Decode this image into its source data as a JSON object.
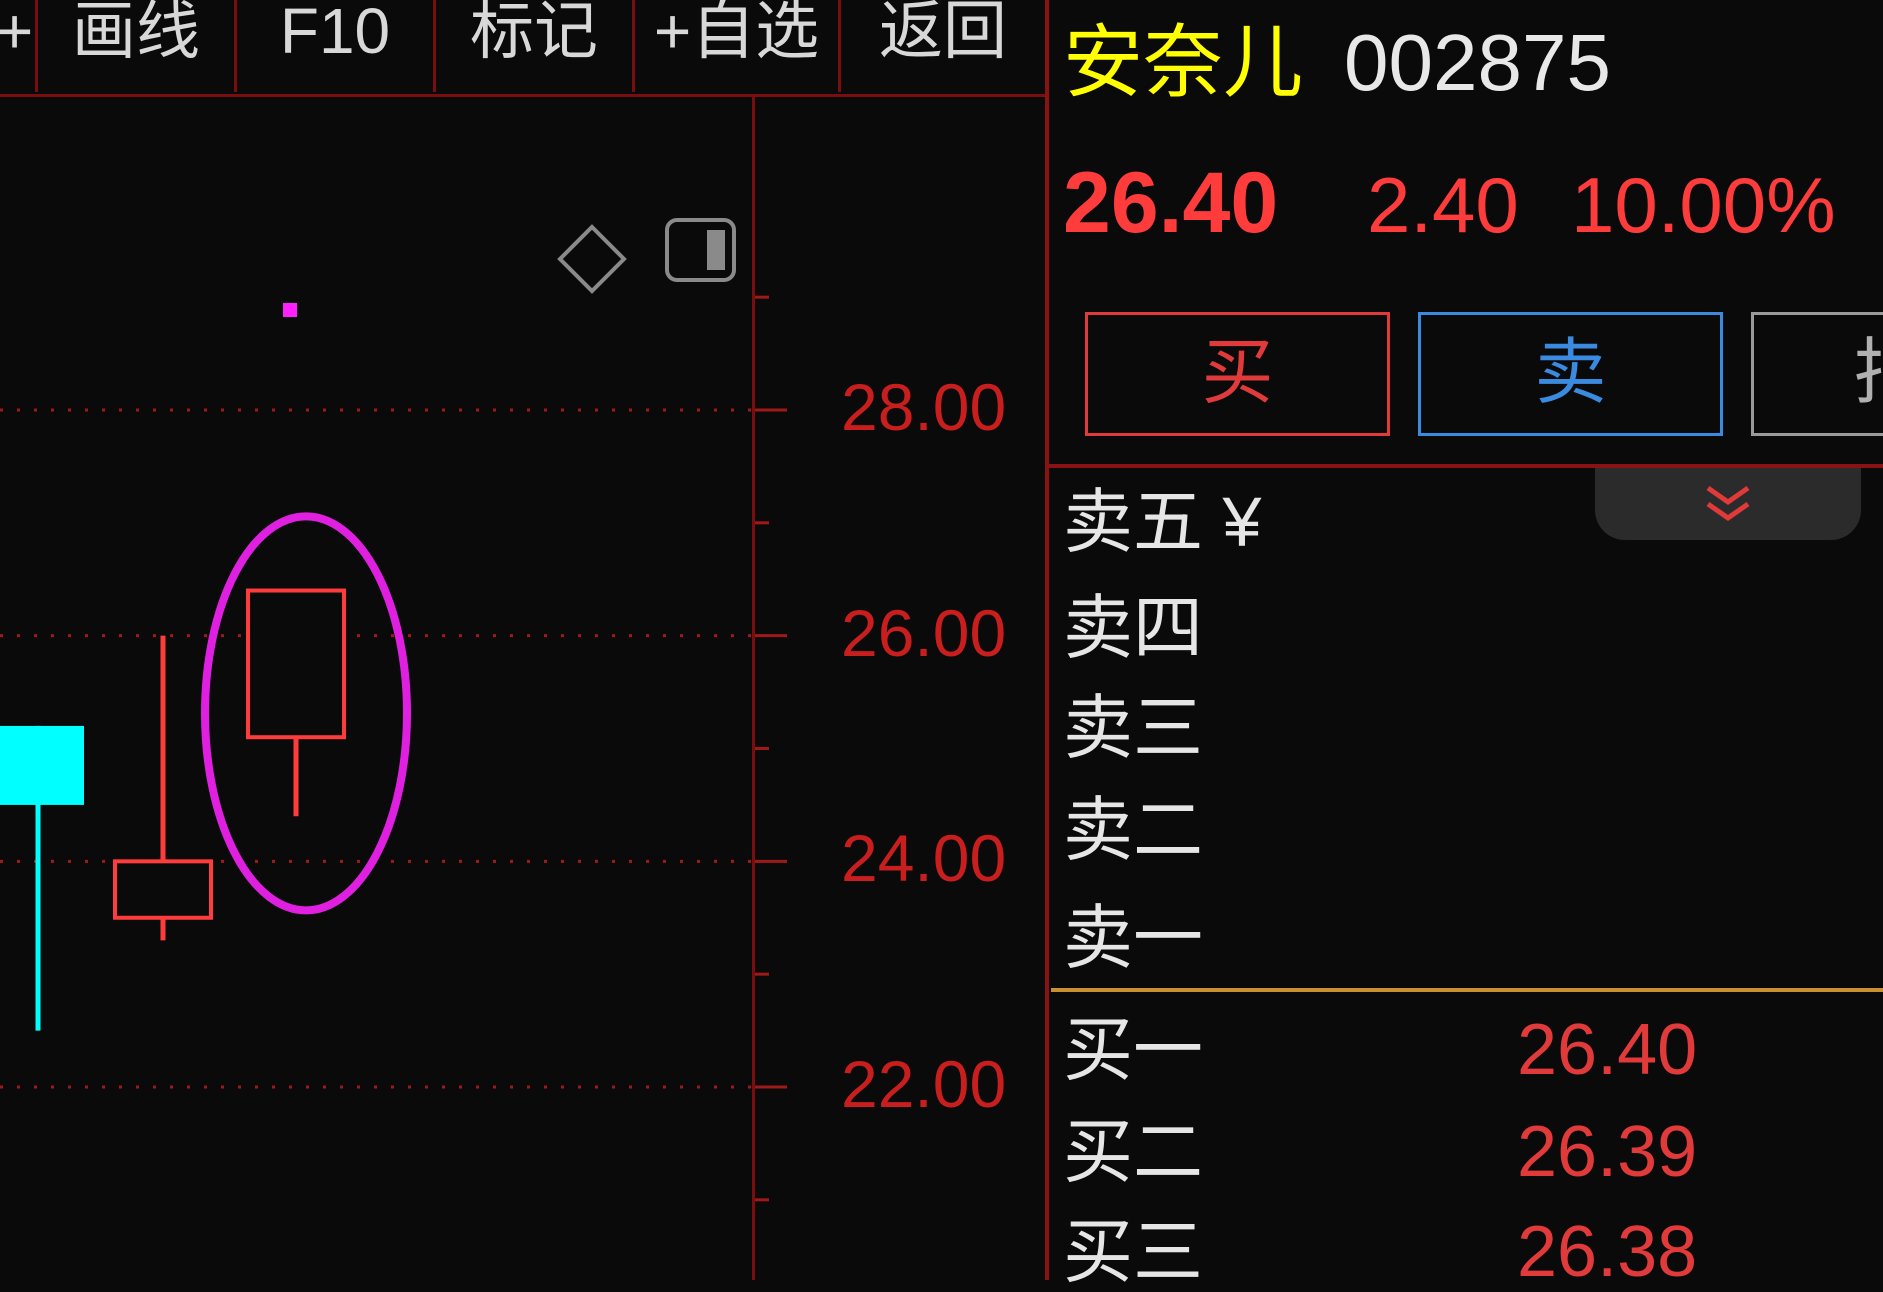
{
  "toolbar": {
    "items": [
      {
        "label": "+"
      },
      {
        "label": "画线"
      },
      {
        "label": "F10"
      },
      {
        "label": "标记"
      },
      {
        "label": "+自选"
      },
      {
        "label": "返回"
      }
    ]
  },
  "stock": {
    "name": "安奈儿",
    "code": "002875",
    "price": "26.40",
    "change": "2.40",
    "change_pct": "10.00%"
  },
  "trade": {
    "buy_label": "买",
    "sell_label": "卖",
    "third_label": "拍"
  },
  "order_book": {
    "asks": [
      {
        "label": "卖五 ¥"
      },
      {
        "label": "卖四"
      },
      {
        "label": "卖三"
      },
      {
        "label": "卖二"
      },
      {
        "label": "卖一"
      }
    ],
    "bids": [
      {
        "label": "买一",
        "price": "26.40"
      },
      {
        "label": "买二",
        "price": "26.39"
      },
      {
        "label": "买三",
        "price": "26.38"
      }
    ]
  },
  "chart_data": {
    "type": "candlestick",
    "price_axis": {
      "ticks": [
        "28.00",
        "26.00",
        "24.00",
        "22.00"
      ],
      "range": [
        20.0,
        30.5
      ]
    },
    "candles": [
      {
        "open": 24.5,
        "close": 25.2,
        "high": 25.2,
        "low": 22.5,
        "direction": "down",
        "color": "#00ffff"
      },
      {
        "open": 23.5,
        "close": 24.0,
        "high": 26.0,
        "low": 23.3,
        "direction": "up",
        "color": "#ff3c3c"
      },
      {
        "open": 25.1,
        "close": 26.4,
        "high": 26.4,
        "low": 24.4,
        "direction": "up",
        "color": "#ff3c3c",
        "highlighted": true
      }
    ],
    "highlight_color": "#e020e0",
    "grid": true
  },
  "colors": {
    "background": "#0a0a0a",
    "axis": "#7a0d0d",
    "up": "#ff3c3c",
    "down": "#00ffff",
    "name": "#ffff00"
  }
}
